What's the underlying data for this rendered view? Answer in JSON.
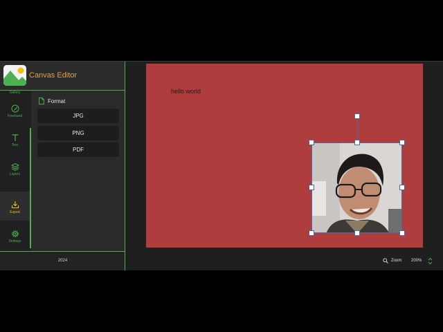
{
  "app": {
    "title": "Canvas Editor",
    "accent_color": "#4caf50",
    "title_color": "#e4a040"
  },
  "rail": {
    "gallery_label": "Gallery",
    "items": [
      {
        "label": "Freehand",
        "icon": "pen-icon"
      },
      {
        "label": "Text",
        "icon": "text-icon"
      },
      {
        "label": "Layers",
        "icon": "layers-icon"
      },
      {
        "label": "Export",
        "icon": "export-icon",
        "active": true
      },
      {
        "label": "Settings",
        "icon": "gear-icon"
      }
    ]
  },
  "panel": {
    "heading": "Format",
    "heading_icon": "file-icon",
    "options": [
      "JPG",
      "PNG",
      "PDF"
    ]
  },
  "footer": {
    "year": "2024"
  },
  "canvas": {
    "background": "#b03d3d",
    "text": "hello world"
  },
  "status": {
    "zoom_label": "Zoom",
    "zoom_value": "200%"
  }
}
